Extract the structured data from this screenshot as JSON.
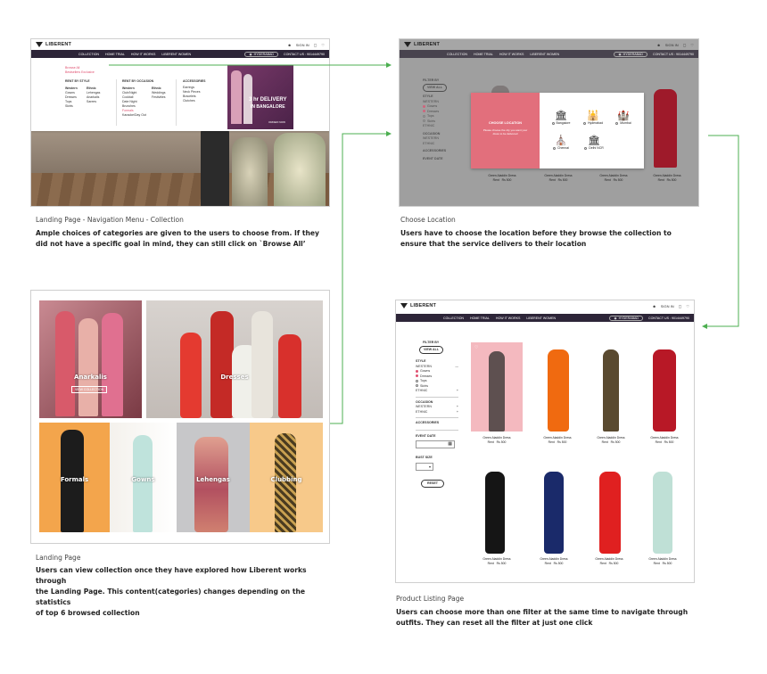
{
  "brand": "LIBERENT",
  "header": {
    "signin": "SIGN IN",
    "nav_links": [
      "COLLECTION",
      "HOME TRIAL",
      "HOW IT WORKS",
      "LIBERENT WOMEN"
    ],
    "location": "HYDERABAD",
    "contact": "CONTACT US : 9014449790"
  },
  "panel1": {
    "title": "Landing Page - Navigation Menu - Collection",
    "desc_lines": [
      "Ample choices of categories are given to the users to choose from. If they",
      "did not have a specific goal in mind, they can still click on `Browse All’"
    ],
    "menu": {
      "browse_all": "Browse All",
      "bestsellers": "Bestsellers Exclusive",
      "rent_by_style": "RENT BY STYLE",
      "western": "Western",
      "western_items": [
        "Gowns",
        "Dresses",
        "Tops",
        "Skirts"
      ],
      "ethnic": "Ethnic",
      "ethnic_items": [
        "Lehengas",
        "Anarkalis",
        "Sarees"
      ],
      "rent_by_occasion": "RENT BY OCCASION",
      "occ_western": "Western",
      "occ_western_items": [
        "Club/Night",
        "Cocktail",
        "Date Night",
        "Brunches",
        "Formals",
        "Karaoke/Day Out"
      ],
      "occ_ethnic": "Ethnic",
      "occ_ethnic_items": [
        "Weddings",
        "Festivities"
      ],
      "accessories": "ACCESSORIES",
      "acc_items": [
        "Earrings",
        "Neck Pieces",
        "Bracelets",
        "Clutches"
      ]
    },
    "promo": {
      "line1": "3 hr DELIVERY",
      "line2": "IN BANGALORE",
      "cta": "ORDER NOW"
    }
  },
  "panel2": {
    "title": "Choose Location",
    "desc_lines": [
      "Users have to choose the location before they browse the collection to",
      "ensure that the service delivers to their location"
    ],
    "modal": {
      "heading": "CHOOSE LOCATION",
      "sub": "Please choose the city you want your dress to be delivered",
      "cities": [
        "Bangalore",
        "Hyderabad",
        "Mumbai",
        "Chennai",
        "Delhi NCR"
      ]
    }
  },
  "panel3": {
    "title": "Landing Page",
    "desc_lines": [
      "Users can view collection once they have explored how Liberent works through",
      "the Landing Page. This content(categories) changes depending on the statistics",
      "of top 6 browsed collection"
    ],
    "tiles": {
      "anarkalis": "Anarkalis",
      "view_collection": "VIEW COLLECTION",
      "dresses": "Dresses",
      "formals": "Formals",
      "gowns": "Gowns",
      "lehengas": "Lehengas",
      "clubbing": "Clubbing"
    }
  },
  "panel4": {
    "title": "Product Listing Page",
    "desc_lines": [
      "Users can choose more than one filter at the same time to navigate through",
      "outfits. They can reset all the filter at just one click"
    ]
  },
  "filters": {
    "filter_by": "FILTER BY",
    "view_all": "VIEW ALL",
    "style": "STYLE",
    "western": "WESTERN",
    "options": [
      "Gowns",
      "Dresses",
      "Tops",
      "Skirts"
    ],
    "ethnic": "ETHNIC",
    "occasion": "OCCASION",
    "occ_western": "WESTERN",
    "occ_ethnic": "ETHNIC",
    "accessories": "ACCESSORIES",
    "event_date": "EVENT DATE",
    "bust_size": "BUST SIZE",
    "reset": "RESET"
  },
  "product": {
    "name": "Green Aladdin Dress",
    "rent": "Rent",
    "price": "Rs 500"
  },
  "colors": {
    "nav": "#2d2538",
    "accent": "#e05070",
    "promo": "#6b2a5a",
    "arrow": "#4caf50",
    "modal_left": "#e26f7c"
  }
}
